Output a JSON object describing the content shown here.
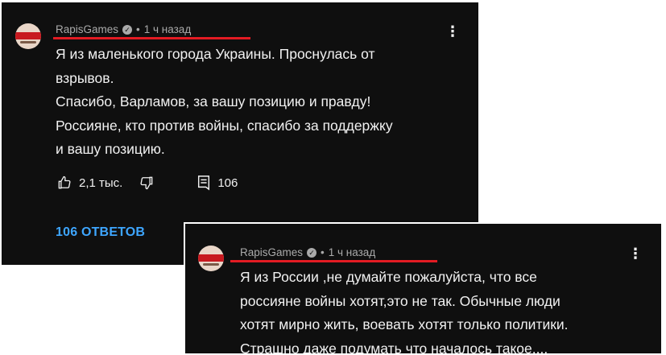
{
  "comments": [
    {
      "author": "RapisGames",
      "time": "1 ч назад",
      "lines": [
        "Я из маленького города Украины. Проснулась от",
        "взрывов.",
        "Спасибо, Варламов, за вашу позицию и правду!",
        "Россияне, кто против войны, спасибо за поддержку",
        "и вашу позицию."
      ],
      "likes": "2,1 тыс.",
      "reply_count": "106",
      "replies_label": "106 ОТВЕТОВ"
    },
    {
      "author": "RapisGames",
      "time": "1 ч назад",
      "lines": [
        "Я из России ,не думайте пожалуйста, что все",
        "россияне войны хотят,это не так. Обычные люди",
        "хотят мирно жить,  воевать хотят только политики.",
        "Страшно даже подумать что началось такое...."
      ]
    }
  ],
  "colors": {
    "background": "#0f0f0f",
    "text": "#f1f1f1",
    "meta": "#aaaaaa",
    "accent_link": "#3ea6ff",
    "highlight_underline": "#e31b23"
  },
  "icons": [
    "thumb-up-icon",
    "thumb-down-icon",
    "comment-icon",
    "verified-check-icon",
    "more-vert-icon"
  ]
}
